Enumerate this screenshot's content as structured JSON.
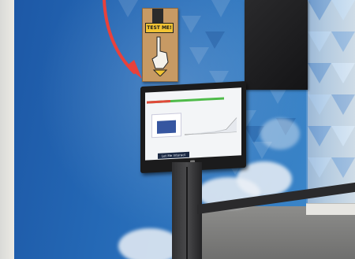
{
  "scene": {
    "description_tags": [
      "exhibit-wall",
      "kiosk",
      "sign",
      "arrow"
    ]
  },
  "sign": {
    "label": "TEST ME!"
  },
  "monitor": {
    "button_label": "Let Me Interact"
  },
  "colors": {
    "mural_blue": "#2468b5",
    "arrow_red": "#e8413c",
    "sign_yellow": "#f2c433",
    "progress_green": "#4fbb4a",
    "progress_red": "#e04a3a"
  }
}
